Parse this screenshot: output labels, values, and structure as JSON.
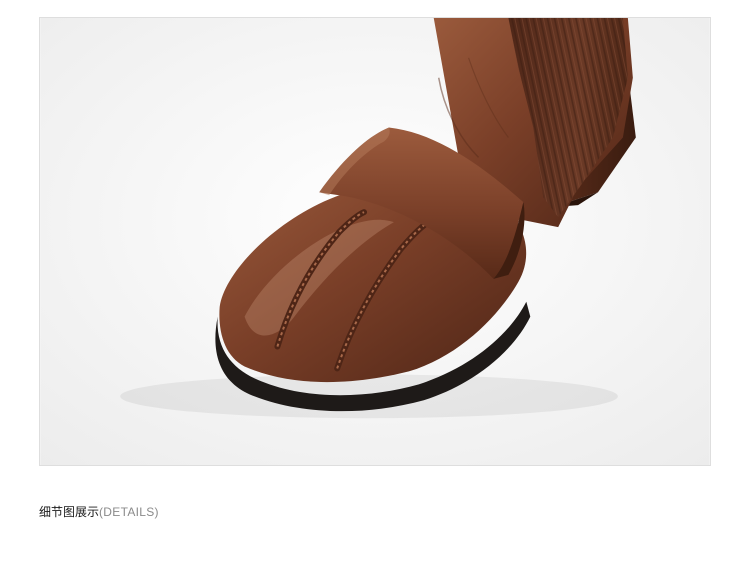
{
  "caption": {
    "zh": "细节图展示",
    "en": "(DETAILS)"
  },
  "product_photo": {
    "subject": "brown-leather-ankle-boot-toe-detail",
    "colors": {
      "leather": "#7a3f28",
      "leather_highlight": "#b07a5c",
      "leather_shadow": "#4e2516",
      "knit": "#6b3a26",
      "sole": "#1e1a18",
      "background": "#f6f6f6",
      "frame_border": "#dedede"
    }
  }
}
